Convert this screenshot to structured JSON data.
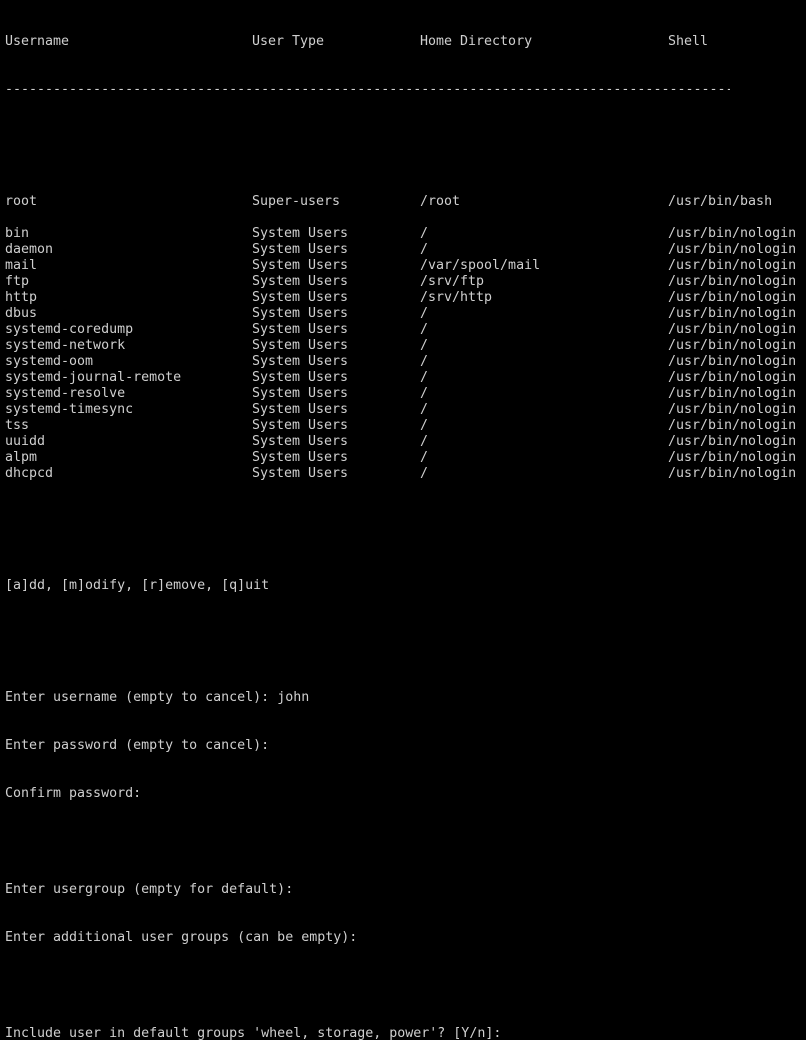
{
  "table": {
    "headers": [
      "Username",
      "User Type",
      "Home Directory",
      "Shell"
    ],
    "divider": "-----------------------------------------------------------------------------------------------------------------------",
    "rows": [
      [
        "root",
        "Super-users",
        "/root",
        "/usr/bin/bash"
      ],
      [
        "bin",
        "System Users",
        "/",
        "/usr/bin/nologin"
      ],
      [
        "daemon",
        "System Users",
        "/",
        "/usr/bin/nologin"
      ],
      [
        "mail",
        "System Users",
        "/var/spool/mail",
        "/usr/bin/nologin"
      ],
      [
        "ftp",
        "System Users",
        "/srv/ftp",
        "/usr/bin/nologin"
      ],
      [
        "http",
        "System Users",
        "/srv/http",
        "/usr/bin/nologin"
      ],
      [
        "dbus",
        "System Users",
        "/",
        "/usr/bin/nologin"
      ],
      [
        "systemd-coredump",
        "System Users",
        "/",
        "/usr/bin/nologin"
      ],
      [
        "systemd-network",
        "System Users",
        "/",
        "/usr/bin/nologin"
      ],
      [
        "systemd-oom",
        "System Users",
        "/",
        "/usr/bin/nologin"
      ],
      [
        "systemd-journal-remote",
        "System Users",
        "/",
        "/usr/bin/nologin"
      ],
      [
        "systemd-resolve",
        "System Users",
        "/",
        "/usr/bin/nologin"
      ],
      [
        "systemd-timesync",
        "System Users",
        "/",
        "/usr/bin/nologin"
      ],
      [
        "tss",
        "System Users",
        "/",
        "/usr/bin/nologin"
      ],
      [
        "uuidd",
        "System Users",
        "/",
        "/usr/bin/nologin"
      ],
      [
        "alpm",
        "System Users",
        "/",
        "/usr/bin/nologin"
      ],
      [
        "dhcpcd",
        "System Users",
        "/",
        "/usr/bin/nologin"
      ]
    ]
  },
  "menu": "[a]dd, [m]odify, [r]emove, [q]uit",
  "prompts": {
    "username_label": "Enter username (empty to cancel): ",
    "username_value": "john",
    "password_label": "Enter password (empty to cancel):",
    "confirm_label": "Confirm password:",
    "usergroup_label": "Enter usergroup (empty for default):",
    "additional_groups_label": "Enter additional user groups (can be empty):",
    "default_groups_label": "Include user in default groups 'wheel, storage, power'? [Y/n]:"
  },
  "colors": {
    "background": "#000000",
    "foreground": "#cfcfcf"
  }
}
